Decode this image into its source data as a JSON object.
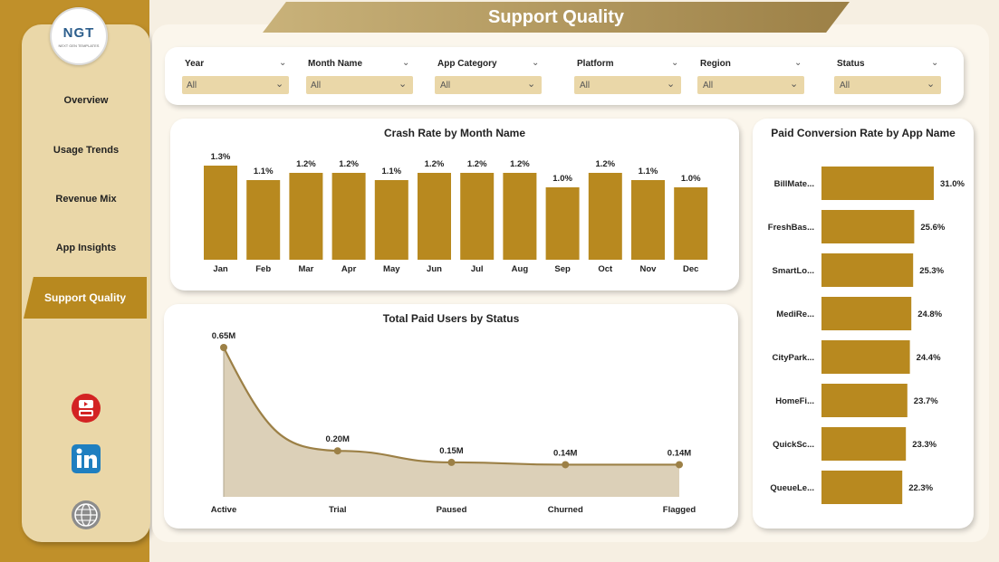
{
  "logo": {
    "text": "NGT",
    "subtext": "NEXT GEN TEMPLATES"
  },
  "nav": [
    {
      "label": "Overview"
    },
    {
      "label": "Usage Trends"
    },
    {
      "label": "Revenue Mix"
    },
    {
      "label": "App Insights"
    },
    {
      "label": "Support Quality",
      "active": true
    }
  ],
  "social": [
    {
      "icon": "youtube-icon"
    },
    {
      "icon": "linkedin-icon"
    },
    {
      "icon": "globe-icon"
    }
  ],
  "page_title": "Support Quality",
  "filters": [
    {
      "label": "Year",
      "value": "All"
    },
    {
      "label": "Month Name",
      "value": "All"
    },
    {
      "label": "App Category",
      "value": "All"
    },
    {
      "label": "Platform",
      "value": "All"
    },
    {
      "label": "Region",
      "value": "All"
    },
    {
      "label": "Status",
      "value": "All"
    }
  ],
  "colors": {
    "accent": "#b8891f",
    "sidebar": "#ead7a8",
    "band": "#c0902a",
    "area": "#dcd0b8",
    "line": "#9c8046"
  },
  "chart_data": [
    {
      "type": "bar",
      "title": "Crash Rate by Month Name",
      "categories": [
        "Jan",
        "Feb",
        "Mar",
        "Apr",
        "May",
        "Jun",
        "Jul",
        "Aug",
        "Sep",
        "Oct",
        "Nov",
        "Dec"
      ],
      "values": [
        1.3,
        1.1,
        1.2,
        1.2,
        1.1,
        1.2,
        1.2,
        1.2,
        1.0,
        1.2,
        1.1,
        1.0
      ],
      "labels": [
        "1.3%",
        "1.1%",
        "1.2%",
        "1.2%",
        "1.1%",
        "1.2%",
        "1.2%",
        "1.2%",
        "1.0%",
        "1.2%",
        "1.1%",
        "1.0%"
      ]
    },
    {
      "type": "bar",
      "orientation": "horizontal",
      "title": "Paid Conversion Rate by App Name",
      "categories": [
        "BillMate...",
        "FreshBas...",
        "SmartLo...",
        "MediRe...",
        "CityPark...",
        "HomeFi...",
        "QuickSc...",
        "QueueLe..."
      ],
      "values": [
        31.0,
        25.6,
        25.3,
        24.8,
        24.4,
        23.7,
        23.3,
        22.3
      ],
      "labels": [
        "31.0%",
        "25.6%",
        "25.3%",
        "24.8%",
        "24.4%",
        "23.7%",
        "23.3%",
        "22.3%"
      ]
    },
    {
      "type": "area",
      "title": "Total Paid Users by Status",
      "categories": [
        "Active",
        "Trial",
        "Paused",
        "Churned",
        "Flagged"
      ],
      "values": [
        0.65,
        0.2,
        0.15,
        0.14,
        0.14
      ],
      "labels": [
        "0.65M",
        "0.20M",
        "0.15M",
        "0.14M",
        "0.14M"
      ]
    }
  ]
}
